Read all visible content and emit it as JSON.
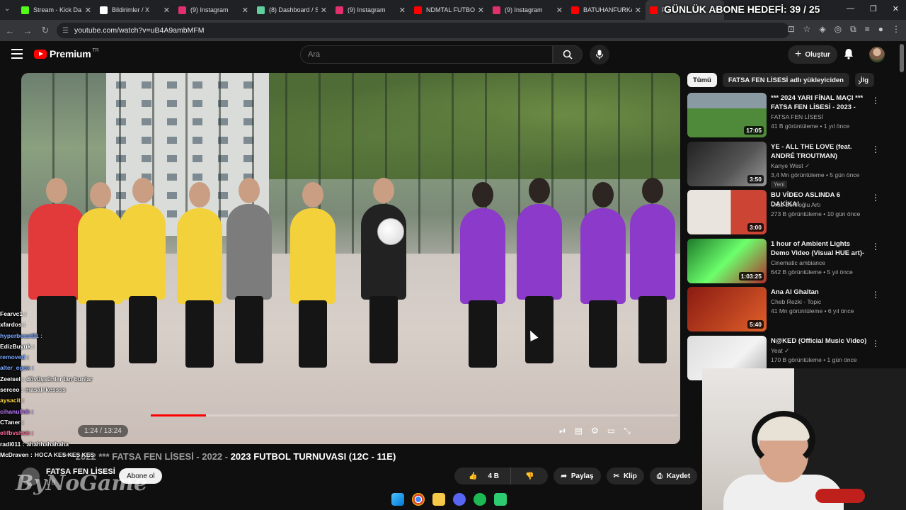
{
  "browser": {
    "tabs": [
      {
        "title": "Stream - Kick Da:",
        "color": "#53fc18"
      },
      {
        "title": "Bildirimler / X",
        "color": "#ffffff"
      },
      {
        "title": "(9) Instagram",
        "color": "#e1306c"
      },
      {
        "title": "(8) Dashboard / S",
        "color": "#5fcf9f"
      },
      {
        "title": "(9) Instagram",
        "color": "#e1306c"
      },
      {
        "title": "NDMTAL FUTBOL",
        "color": "#ff0000"
      },
      {
        "title": "(9) Instagram",
        "color": "#e1306c"
      },
      {
        "title": "BATUHANFURKAN",
        "color": "#ff0000"
      },
      {
        "title": "F...",
        "color": "#ff0000"
      }
    ],
    "url": "youtube.com/watch?v=uB4A9ambMFM"
  },
  "overlay": {
    "subscriber_goal": "GÜNLÜK ABONE HEDEFİ: 39 / 25",
    "watermark": "ByNoGame"
  },
  "youtube": {
    "brand": "Premium",
    "region": "TR",
    "search_placeholder": "Ara",
    "create_label": "Oluştur"
  },
  "video": {
    "time": "1:24 / 13:24",
    "progress": 0.105,
    "title_prefix": "*** 2022 *** FATSA FEN LİSESİ - 2022 - ",
    "title_main": "2023 FUTBOL TURNUVASI (12C - 11E)",
    "channel": "FATSA FEN LİSESİ",
    "channel_subs": "1 B",
    "subscribe_label": "Abone ol",
    "likes": "4 B",
    "share_label": "Paylaş",
    "clip_label": "Klip",
    "save_label": "Kaydet"
  },
  "chips": [
    "Tümü",
    "FATSA FEN LİSESİ adlı yükleyiciden",
    "İlg"
  ],
  "recommendations": [
    {
      "title": "*** 2024 YARI FİNAL MAÇI *** FATSA FEN LİSESİ - 2023 - 20...",
      "channel": "FATSA FEN LİSESİ",
      "meta": "41 B görüntüleme • 1 yıl önce",
      "duration": "17:05",
      "badge": ""
    },
    {
      "title": "YE - ALL THE LOVE (feat. ANDRÉ TROUTMAN)",
      "channel": "Kanye West ✓",
      "meta": "3,4 Mn görüntüleme • 5 gün önce",
      "duration": "3:50",
      "badge": "Yeni"
    },
    {
      "title": "BU VİDEO ASLINDA 6 DAKİKA!",
      "channel": "Uras Benlioğlu Artı",
      "meta": "273 B görüntüleme • 10 gün önce",
      "duration": "3:00",
      "badge": ""
    },
    {
      "title": "1 hour of Ambient Lights Demo Video (Visual HUE art)- Play ...",
      "channel": "Cinematic ambiance",
      "meta": "642 B görüntüleme • 5 yıl önce",
      "duration": "1:03:25",
      "badge": ""
    },
    {
      "title": "Ana Al Ghaltan",
      "channel": "Cheb Rezki - Topic",
      "meta": "41 Mn görüntüleme • 6 yıl önce",
      "duration": "5:40",
      "badge": ""
    },
    {
      "title": "N@KED (Official Music Video)",
      "channel": "Yeat ✓",
      "meta": "170 B görüntüleme • 1 gün önce",
      "duration": "",
      "badge": ""
    }
  ],
  "chat": [
    {
      "user": "Fearvc1 :",
      "msg": "",
      "color": "#ffffff"
    },
    {
      "user": "xfardos :",
      "msg": "",
      "color": "#ffffff"
    },
    {
      "user": "hyperbeast01 :",
      "msg": "",
      "color": "#7aa7ff"
    },
    {
      "user": "EdizBuyuk :",
      "msg": "",
      "color": "#ffffff"
    },
    {
      "user": "removed :",
      "msg": "",
      "color": "#7aa7ff"
    },
    {
      "user": "alter_egox :",
      "msg": "",
      "color": "#7aa7ff"
    },
    {
      "user": "Zeeisel :",
      "msg": "dövüşsünler lan bunlar",
      "color": "#ffffff"
    },
    {
      "user": "serceo :",
      "msg": "masalı kessss",
      "color": "#ffffff"
    },
    {
      "user": "aysacit :",
      "msg": "",
      "color": "#ffd84d"
    },
    {
      "user": "cihanullah :",
      "msg": "",
      "color": "#c07cff"
    },
    {
      "user": "CTaner :",
      "msg": "",
      "color": "#ffffff"
    },
    {
      "user": "elifbvshvn :",
      "msg": "",
      "color": "#ff6b9a"
    },
    {
      "user": "radi011 :",
      "msg": "ahahhahahaha",
      "color": "#ffffff"
    },
    {
      "user": "McDraven :",
      "msg": "HOCA KES KES KES",
      "color": "#ffffff"
    }
  ]
}
